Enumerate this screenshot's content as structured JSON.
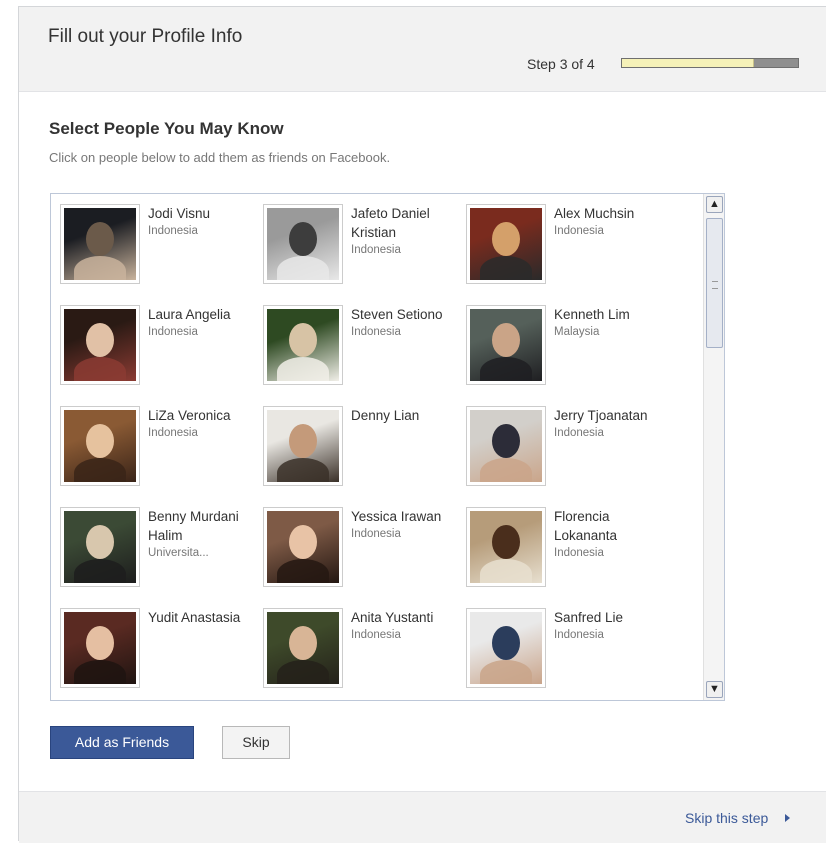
{
  "header": {
    "title": "Fill out your Profile Info",
    "step_label": "Step 3 of 4",
    "progress": 0.75
  },
  "section": {
    "title": "Select People You May Know",
    "subtitle": "Click on people below to add them as friends on Facebook."
  },
  "people": [
    {
      "name": "Jodi Visnu",
      "location": "Indonesia",
      "colors": [
        "#1b1d22",
        "#6b5a4a",
        "#c9b39c"
      ]
    },
    {
      "name": "Jafeto Daniel Kristian",
      "location": "Indonesia",
      "colors": [
        "#9a9a9a",
        "#3d3d3d",
        "#e8e8e8"
      ]
    },
    {
      "name": "Alex Muchsin",
      "location": "Indonesia",
      "colors": [
        "#7a2b1e",
        "#d4a06a",
        "#2a2a2a"
      ]
    },
    {
      "name": "Laura Angelia",
      "location": "Indonesia",
      "colors": [
        "#2a1a14",
        "#e1c1a6",
        "#8b3b33"
      ]
    },
    {
      "name": "Steven Setiono",
      "location": "Indonesia",
      "colors": [
        "#2e4a22",
        "#d7c3a5",
        "#f1efe8"
      ]
    },
    {
      "name": "Kenneth Lim",
      "location": "Malaysia",
      "colors": [
        "#55605a",
        "#caa487",
        "#1f1f22"
      ]
    },
    {
      "name": "LiZa Veronica",
      "location": "Indonesia",
      "colors": [
        "#8a5a34",
        "#e6c29e",
        "#3a2418"
      ]
    },
    {
      "name": "Denny Lian",
      "location": "",
      "colors": [
        "#e9e7e2",
        "#c49a7a",
        "#3a3028"
      ]
    },
    {
      "name": "Jerry Tjoanatan",
      "location": "Indonesia",
      "colors": [
        "#d2cfca",
        "#2c2c38",
        "#caa58a"
      ]
    },
    {
      "name": "Benny Murdani Halim",
      "location": "Universita...",
      "colors": [
        "#3b4a35",
        "#d8c7ad",
        "#1d1d1d"
      ]
    },
    {
      "name": "Yessica Irawan",
      "location": "Indonesia",
      "colors": [
        "#7e5a46",
        "#e8c3a6",
        "#241712"
      ]
    },
    {
      "name": "Florencia Lokananta",
      "location": "Indonesia",
      "colors": [
        "#b69c7a",
        "#4a2e1c",
        "#e7dfcf"
      ]
    },
    {
      "name": "Yudit Anastasia",
      "location": "",
      "colors": [
        "#5a2a22",
        "#e5bfa2",
        "#1f1411"
      ]
    },
    {
      "name": "Anita Yustanti",
      "location": "Indonesia",
      "colors": [
        "#3e4a2a",
        "#d8b596",
        "#24211a"
      ]
    },
    {
      "name": "Sanfred Lie",
      "location": "Indonesia",
      "colors": [
        "#e9e9e9",
        "#2b3d5c",
        "#c9a48a"
      ]
    }
  ],
  "buttons": {
    "add": "Add as Friends",
    "skip": "Skip"
  },
  "footer": {
    "skip_step": "Skip this step"
  }
}
